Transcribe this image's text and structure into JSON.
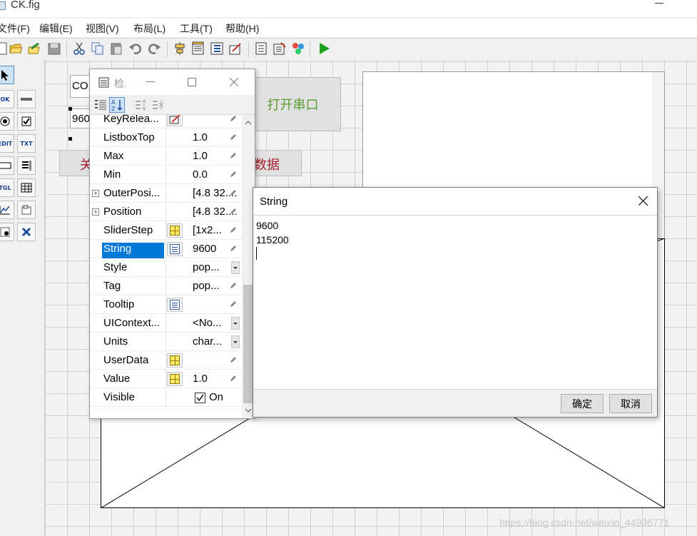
{
  "window": {
    "title": "CK.fig"
  },
  "menu": [
    "文件(F)",
    "编辑(E)",
    "视图(V)",
    "布局(L)",
    "工具(T)",
    "帮助(H)"
  ],
  "figure": {
    "popup_com_text": "CO",
    "popup_baud_text": "960",
    "btn_open_text": "打开串口",
    "btn_close_text": "关",
    "btn_data_text": "数据"
  },
  "inspector": {
    "title": "检.",
    "properties": [
      {
        "name": "KeyRelea...",
        "value": "",
        "editor": "callback",
        "control": "pencil"
      },
      {
        "name": "ListboxTop",
        "value": "1.0",
        "editor": "",
        "control": "pencil"
      },
      {
        "name": "Max",
        "value": "1.0",
        "editor": "",
        "control": "pencil"
      },
      {
        "name": "Min",
        "value": "0.0",
        "editor": "",
        "control": "pencil"
      },
      {
        "name": "OuterPosi...",
        "value": "[4.8 32....",
        "editor": "",
        "control": "pencil",
        "expandable": true
      },
      {
        "name": "Position",
        "value": "[4.8 32....",
        "editor": "",
        "control": "pencil",
        "expandable": true
      },
      {
        "name": "SliderStep",
        "value": "[1x2...",
        "editor": "grid",
        "control": "pencil"
      },
      {
        "name": "String",
        "value": "9600",
        "editor": "text",
        "control": "pencil",
        "selected": true
      },
      {
        "name": "Style",
        "value": "pop...",
        "editor": "",
        "control": "dropdown"
      },
      {
        "name": "Tag",
        "value": "pop...",
        "editor": "",
        "control": "pencil"
      },
      {
        "name": "Tooltip",
        "value": "",
        "editor": "text",
        "control": "pencil"
      },
      {
        "name": "UIContext...",
        "value": "<No...",
        "editor": "",
        "control": "dropdown"
      },
      {
        "name": "Units",
        "value": "char...",
        "editor": "",
        "control": "dropdown"
      },
      {
        "name": "UserData",
        "value": "",
        "editor": "grid",
        "control": "pencil"
      },
      {
        "name": "Value",
        "value": "1.0",
        "editor": "grid",
        "control": "pencil"
      },
      {
        "name": "Visible",
        "value": "On",
        "editor": "",
        "control": "checkbox"
      }
    ]
  },
  "dialog": {
    "title": "String",
    "lines": [
      "9600",
      "115200"
    ],
    "ok_label": "确定",
    "cancel_label": "取消"
  },
  "watermark": "https://blog.csdn.net/weixin_44936771",
  "colors": {
    "selection": "#0078d7",
    "open_button_text": "#5c9c2e",
    "close_button_text": "#a11e2e",
    "run_icon": "#1ea01e"
  }
}
